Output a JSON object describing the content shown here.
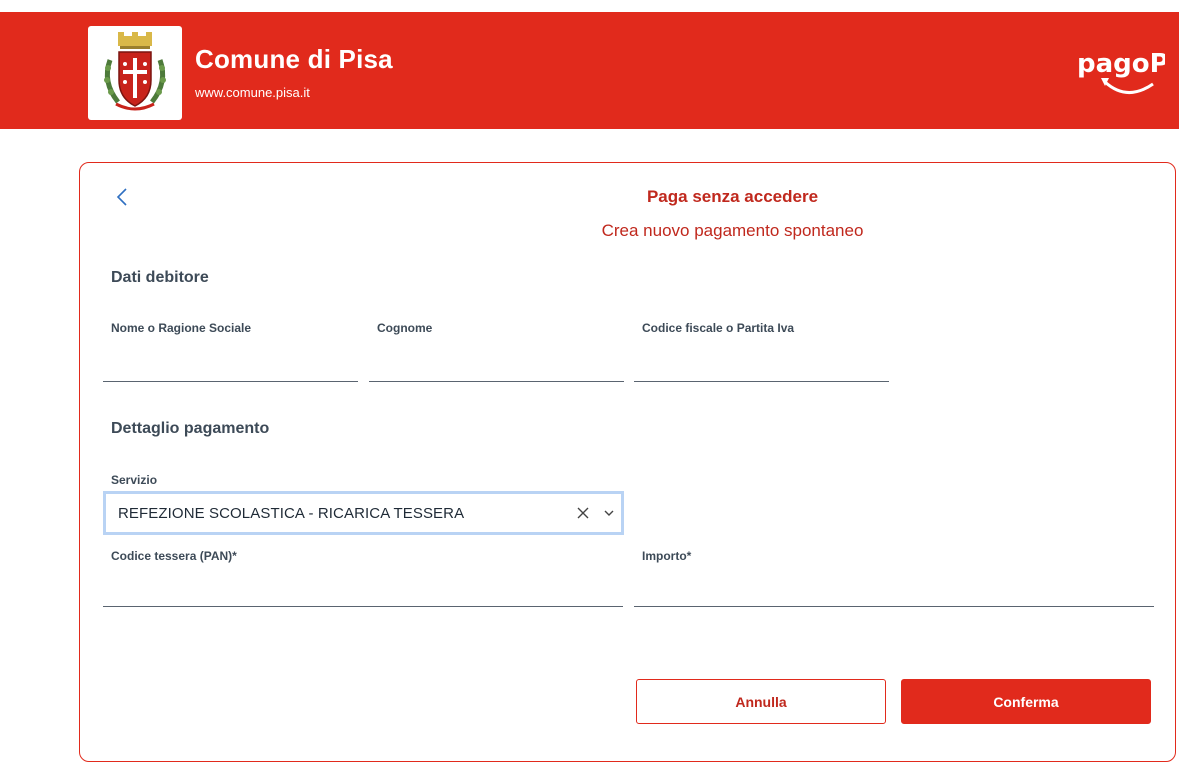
{
  "header": {
    "title": "Comune di Pisa",
    "url": "www.comune.pisa.it",
    "logo": "pisa-coat-of-arms",
    "payment_brand": "pagoPA",
    "bg_color": "#e12a1c"
  },
  "card": {
    "back_icon": "chevron-left-icon",
    "title": "Paga senza accedere",
    "subtitle": "Crea nuovo pagamento spontaneo"
  },
  "debtor": {
    "section_title": "Dati debitore",
    "name_label": "Nome o Ragione Sociale",
    "name_value": "",
    "surname_label": "Cognome",
    "surname_value": "",
    "taxcode_label": "Codice fiscale o Partita Iva",
    "taxcode_value": ""
  },
  "payment": {
    "section_title": "Dettaglio pagamento",
    "service_label": "Servizio",
    "service_value": "REFEZIONE SCOLASTICA - RICARICA TESSERA",
    "card_code_label": "Codice tessera (PAN)*",
    "card_code_value": "",
    "amount_label": "Importo*",
    "amount_value": ""
  },
  "actions": {
    "cancel_label": "Annulla",
    "confirm_label": "Conferma"
  },
  "colors": {
    "accent": "#e12a1c",
    "accent_text": "#c0281d",
    "focus_border": "#b9d3f4"
  }
}
